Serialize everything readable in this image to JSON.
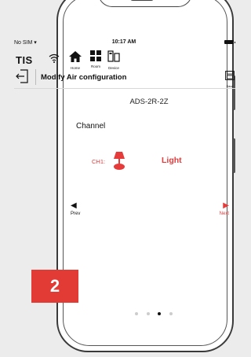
{
  "status_bar": {
    "carrier": "No SIM",
    "time": "10:17 AM"
  },
  "nav": {
    "logo": "TIS",
    "items": [
      {
        "label": "Home"
      },
      {
        "label": "Room"
      },
      {
        "label": "Device"
      }
    ]
  },
  "header": {
    "title": "Modify Air configuration",
    "save_label": "Save"
  },
  "content": {
    "device_name": "ADS-2R-2Z",
    "channel_heading": "Channel",
    "channel_label": "CH1:",
    "channel_value": "Light"
  },
  "pager": {
    "prev_label": "Prev",
    "next_label": "Next",
    "page_count": 4,
    "active_page": 3
  },
  "step_badge": "2",
  "colors": {
    "accent": "#e53b3b",
    "badge": "#e23b36"
  }
}
